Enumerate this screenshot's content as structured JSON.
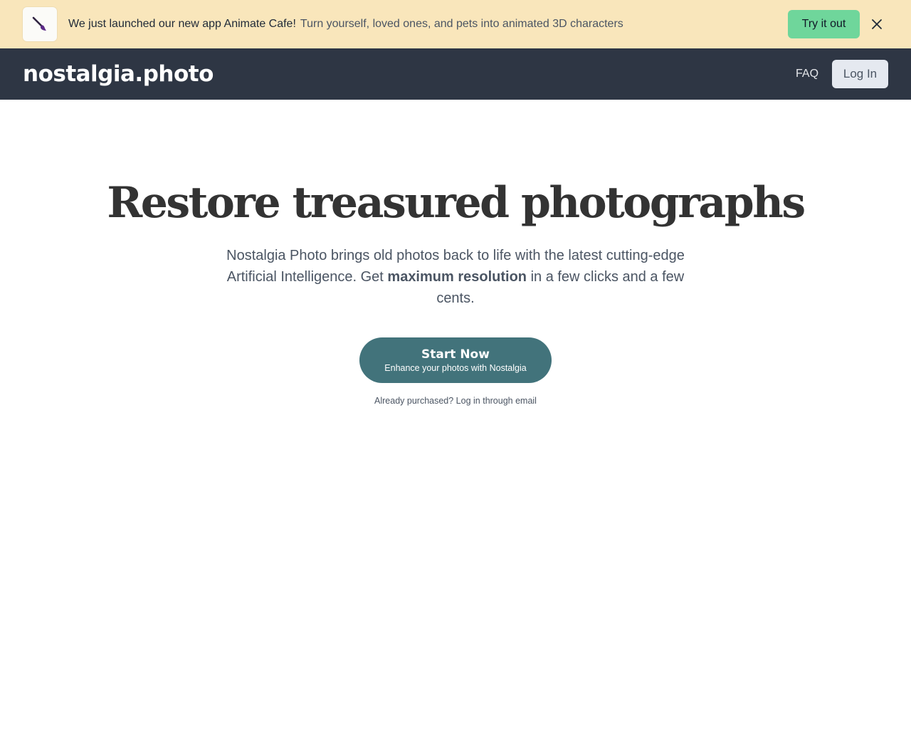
{
  "banner": {
    "app_icon": "paintbrush-icon",
    "headline": "We just launched our new app Animate Cafe!",
    "subtext": "Turn yourself, loved ones, and pets into animated 3D characters",
    "cta_label": "Try it out",
    "close_icon": "close-icon",
    "background_color": "#f9e6bb",
    "cta_color": "#6fd69b"
  },
  "navbar": {
    "logo": "nostalgia.photo",
    "faq_label": "FAQ",
    "login_label": "Log In",
    "background_color": "#2e3644"
  },
  "hero": {
    "title": "Restore treasured photographs",
    "description_part1": "Nostalgia Photo brings old photos back to life with the latest cutting-edge Artificial Intelligence. Get ",
    "description_bold": "maximum resolution",
    "description_part2": " in a few clicks and a few cents.",
    "cta_title": "Start Now",
    "cta_subtitle": "Enhance your photos with Nostalgia",
    "cta_color": "#42737b",
    "login_link": "Already purchased? Log in through email"
  }
}
